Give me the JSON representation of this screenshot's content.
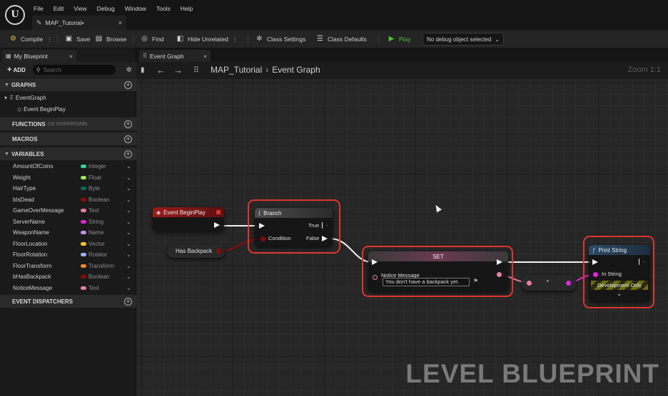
{
  "menu": [
    "File",
    "Edit",
    "View",
    "Debug",
    "Window",
    "Tools",
    "Help"
  ],
  "document_tab": {
    "label": "MAP_Tutorial•"
  },
  "toolbar": {
    "compile": "Compile",
    "save": "Save",
    "browse": "Browse",
    "find": "Find",
    "hide_unrelated": "Hide Unrelated",
    "class_settings": "Class Settings",
    "class_defaults": "Class Defaults",
    "play": "Play",
    "debug_object": "No debug object selected"
  },
  "my_blueprint": {
    "tab_label": "My Blueprint",
    "add_label": "ADD",
    "search_placeholder": "Search",
    "sections": {
      "graphs": "GRAPHS",
      "functions": "FUNCTIONS",
      "functions_sub": "(19 OVERRIDABL",
      "macros": "MACROS",
      "variables": "VARIABLES",
      "event_dispatchers": "EVENT DISPATCHERS"
    },
    "graph_items": {
      "event_graph": "EventGraph",
      "event_begin_play": "Event BeginPlay"
    },
    "variables": [
      {
        "name": "AmountOfCoins",
        "type": "Integer",
        "color": "#2fd5a0"
      },
      {
        "name": "Weight",
        "type": "Float",
        "color": "#9be35a"
      },
      {
        "name": "HairType",
        "type": "Byte",
        "color": "#0a6b5c"
      },
      {
        "name": "bIsDead",
        "type": "Boolean",
        "color": "#8a0b0b"
      },
      {
        "name": "GameOverMessage",
        "type": "Text",
        "color": "#e77ea6"
      },
      {
        "name": "ServerName",
        "type": "String",
        "color": "#e027d9"
      },
      {
        "name": "WeaponName",
        "type": "Name",
        "color": "#c390e6"
      },
      {
        "name": "FloorLocation",
        "type": "Vector",
        "color": "#f5c32e"
      },
      {
        "name": "FloorRotation",
        "type": "Rotator",
        "color": "#9eb2f0"
      },
      {
        "name": "FloorTransform",
        "type": "Transform",
        "color": "#f08a2c"
      },
      {
        "name": "bHasBackpack",
        "type": "Boolean",
        "color": "#8a0b0b"
      },
      {
        "name": "NoticeMessage",
        "type": "Text",
        "color": "#e77ea6"
      }
    ]
  },
  "graph": {
    "tab_label": "Event Graph",
    "breadcrumb": [
      "MAP_Tutorial",
      "Event Graph"
    ],
    "zoom": "Zoom 1:1",
    "nodes": {
      "begin_play": {
        "title": "Event BeginPlay"
      },
      "has_backpack": {
        "title": "Has Backpack"
      },
      "branch": {
        "title": "Branch",
        "condition": "Condition",
        "true_label": "True",
        "false_label": "False"
      },
      "set": {
        "title": "SET",
        "var": "Notice Message",
        "value": "You don't have a backpack yet."
      },
      "print_string": {
        "title": "Print String",
        "in_string": "In String",
        "dev_only": "Development Only"
      }
    },
    "colors": {
      "highlight": "#e0342e",
      "exec": "#f2f2f2",
      "text_pin": "#e77ea6",
      "string_pin": "#e027d9",
      "bool_pin": "#8a0b0b",
      "event_head": "#8a1a1a",
      "function_head": "#2c4a66"
    }
  },
  "watermark": "LEVEL BLUEPRINT"
}
